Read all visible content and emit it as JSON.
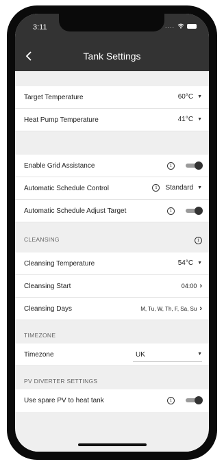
{
  "status": {
    "time": "3:11",
    "signal": "....",
    "wifi": "wifi-icon",
    "battery": "battery-icon"
  },
  "nav": {
    "title": "Tank Settings",
    "back_icon": "chevron-left-icon"
  },
  "temperatures": {
    "target_label": "Target Temperature",
    "target_value": "60°C",
    "heatpump_label": "Heat Pump Temperature",
    "heatpump_value": "41°C"
  },
  "grid": {
    "enable_label": "Enable Grid Assistance",
    "schedule_label": "Automatic Schedule Control",
    "schedule_value": "Standard",
    "adjust_label": "Automatic Schedule Adjust Target",
    "enable_on": true,
    "adjust_on": true
  },
  "cleansing": {
    "header": "CLEANSING",
    "temp_label": "Cleansing Temperature",
    "temp_value": "54°C",
    "start_label": "Cleansing Start",
    "start_value": "04:00",
    "days_label": "Cleansing Days",
    "days_value": "M, Tu, W, Th, F, Sa, Su"
  },
  "timezone": {
    "header": "TIMEZONE",
    "label": "Timezone",
    "value": "UK"
  },
  "pv": {
    "header": "PV DIVERTER SETTINGS",
    "label": "Use spare PV to heat tank",
    "on": true
  },
  "colors": {
    "header_bg": "#333333",
    "page_bg": "#efefef",
    "toggle_knob": "#333333",
    "toggle_track": "#9a9a9a"
  }
}
